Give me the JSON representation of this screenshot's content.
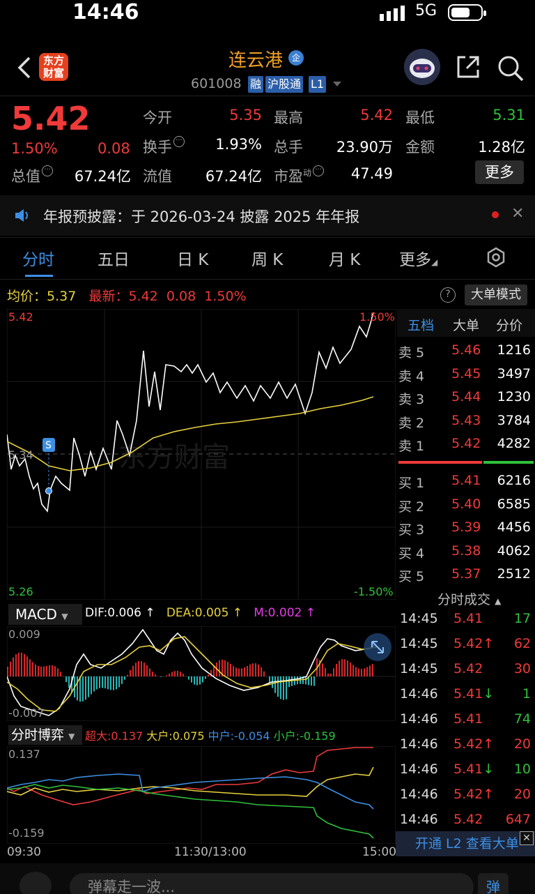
{
  "status_bar": {
    "time": "14:46",
    "network": "5G"
  },
  "header": {
    "title": "连云港",
    "stock_code": "601008",
    "tags": [
      "融",
      "沪股通",
      "L1"
    ],
    "logo_text_line1": "东方",
    "logo_text_line2": "财富",
    "title_badge": "企"
  },
  "quote": {
    "price": "5.42",
    "change_pct": "1.50%",
    "change": "0.08",
    "labels": {
      "open": "今开",
      "high": "最高",
      "low": "最低",
      "turnover": "换手",
      "volume": "总手",
      "amount": "金额",
      "mktcap": "总值",
      "float_cap": "流值",
      "pe": "市盈",
      "pe_sup": "动"
    },
    "values": {
      "open": "5.35",
      "high": "5.42",
      "low": "5.31",
      "turnover": "1.93%",
      "volume": "23.90万",
      "amount": "1.28亿",
      "mktcap": "67.24亿",
      "float_cap": "67.24亿",
      "pe": "47.49"
    },
    "more_label": "更多"
  },
  "notice": {
    "text": "年报预披露：于 2026-03-24 披露 2025 年年报"
  },
  "tabs": [
    "分时",
    "五日",
    "日 K",
    "周 K",
    "月 K",
    "更多"
  ],
  "intraday": {
    "avg_label": "均价：",
    "avg_value": "5.37",
    "last_label": "最新：",
    "last_value": "5.42",
    "last_change": "0.08",
    "last_pct": "1.50%",
    "mode_label": "大单模式",
    "help_glyph": "?",
    "y_top": "5.42",
    "y_mid": "5.34",
    "y_bottom": "5.26",
    "pct_top": "1.50%",
    "pct_bottom": "-1.50%",
    "marker": "S",
    "watermark": "东方财富"
  },
  "chart_data": {
    "type": "line",
    "x_range": [
      "09:30",
      "15:00"
    ],
    "ylim": [
      5.26,
      5.42
    ],
    "series": [
      {
        "values": [
          5.33,
          5.32,
          5.31,
          5.33,
          5.34,
          5.33,
          5.35,
          5.36,
          5.38,
          5.38,
          5.39,
          5.38,
          5.39,
          5.38,
          5.38,
          5.38,
          5.38,
          5.38,
          5.37,
          5.38,
          5.37,
          5.38,
          5.37,
          5.37,
          5.37,
          5.38,
          5.4,
          5.4,
          5.4,
          5.4,
          5.41,
          5.42
        ]
      },
      {
        "values": [
          5.33,
          5.33,
          5.33,
          5.33,
          5.33,
          5.33,
          5.34,
          5.34,
          5.34,
          5.35,
          5.35,
          5.35,
          5.35,
          5.35,
          5.35,
          5.36,
          5.36,
          5.36,
          5.36,
          5.36,
          5.36,
          5.36,
          5.36,
          5.36,
          5.37,
          5.37,
          5.37,
          5.37,
          5.37,
          5.37,
          5.37,
          5.37
        ]
      }
    ]
  },
  "order_book": {
    "tabs": [
      "五档",
      "大单",
      "分价"
    ],
    "asks": [
      {
        "label": "卖 5",
        "price": "5.46",
        "vol": "1216"
      },
      {
        "label": "卖 4",
        "price": "5.45",
        "vol": "3497"
      },
      {
        "label": "卖 3",
        "price": "5.44",
        "vol": "1230"
      },
      {
        "label": "卖 2",
        "price": "5.43",
        "vol": "3784"
      },
      {
        "label": "卖 1",
        "price": "5.42",
        "vol": "4282"
      }
    ],
    "bids": [
      {
        "label": "买 1",
        "price": "5.41",
        "vol": "6216"
      },
      {
        "label": "买 2",
        "price": "5.40",
        "vol": "6585"
      },
      {
        "label": "买 3",
        "price": "5.39",
        "vol": "4456"
      },
      {
        "label": "买 4",
        "price": "5.38",
        "vol": "4062"
      },
      {
        "label": "买 5",
        "price": "5.37",
        "vol": "2512"
      }
    ]
  },
  "ticks": {
    "title": "分时成交",
    "rows": [
      {
        "time": "14:45",
        "price": "5.41",
        "arrow": "",
        "vol": "17",
        "color": "#2fc13c"
      },
      {
        "time": "14:45",
        "price": "5.42",
        "arrow": "↑",
        "vol": "62",
        "color": "#f03a3a"
      },
      {
        "time": "14:45",
        "price": "5.42",
        "arrow": "",
        "vol": "30",
        "color": "#f03a3a"
      },
      {
        "time": "14:46",
        "price": "5.41",
        "arrow": "↓",
        "vol": "1",
        "color": "#2fc13c"
      },
      {
        "time": "14:46",
        "price": "5.41",
        "arrow": "",
        "vol": "74",
        "color": "#2fc13c"
      },
      {
        "time": "14:46",
        "price": "5.42",
        "arrow": "↑",
        "vol": "20",
        "color": "#f03a3a"
      },
      {
        "time": "14:46",
        "price": "5.41",
        "arrow": "↓",
        "vol": "10",
        "color": "#2fc13c"
      },
      {
        "time": "14:46",
        "price": "5.42",
        "arrow": "↑",
        "vol": "20",
        "color": "#f03a3a"
      },
      {
        "time": "14:46",
        "price": "5.42",
        "arrow": "",
        "vol": "647",
        "color": "#f03a3a"
      }
    ],
    "l2_label": "开通 L2 查看大单"
  },
  "macd": {
    "selector": "MACD",
    "dif": "DIF:0.006 ↑",
    "dea": "DEA:0.005 ↑",
    "m": "M:0.002 ↑",
    "y_top": "0.009",
    "y_bottom": "-0.007"
  },
  "game": {
    "selector": "分时博弈",
    "super": "超大:0.137",
    "big": "大户:0.075",
    "mid": "中户:-0.054",
    "small": "小户:-0.159",
    "y_top": "0.137",
    "y_bottom": "-0.159"
  },
  "time_axis": [
    "09:30",
    "11:30/13:00",
    "15:00"
  ],
  "bottom": {
    "placeholder": "弹幕走一波...",
    "send_glyph": "弹"
  },
  "colors": {
    "up": "#f03a3a",
    "down": "#2fc13c",
    "accent": "#3d8fe4",
    "avg": "#e8d23d"
  }
}
